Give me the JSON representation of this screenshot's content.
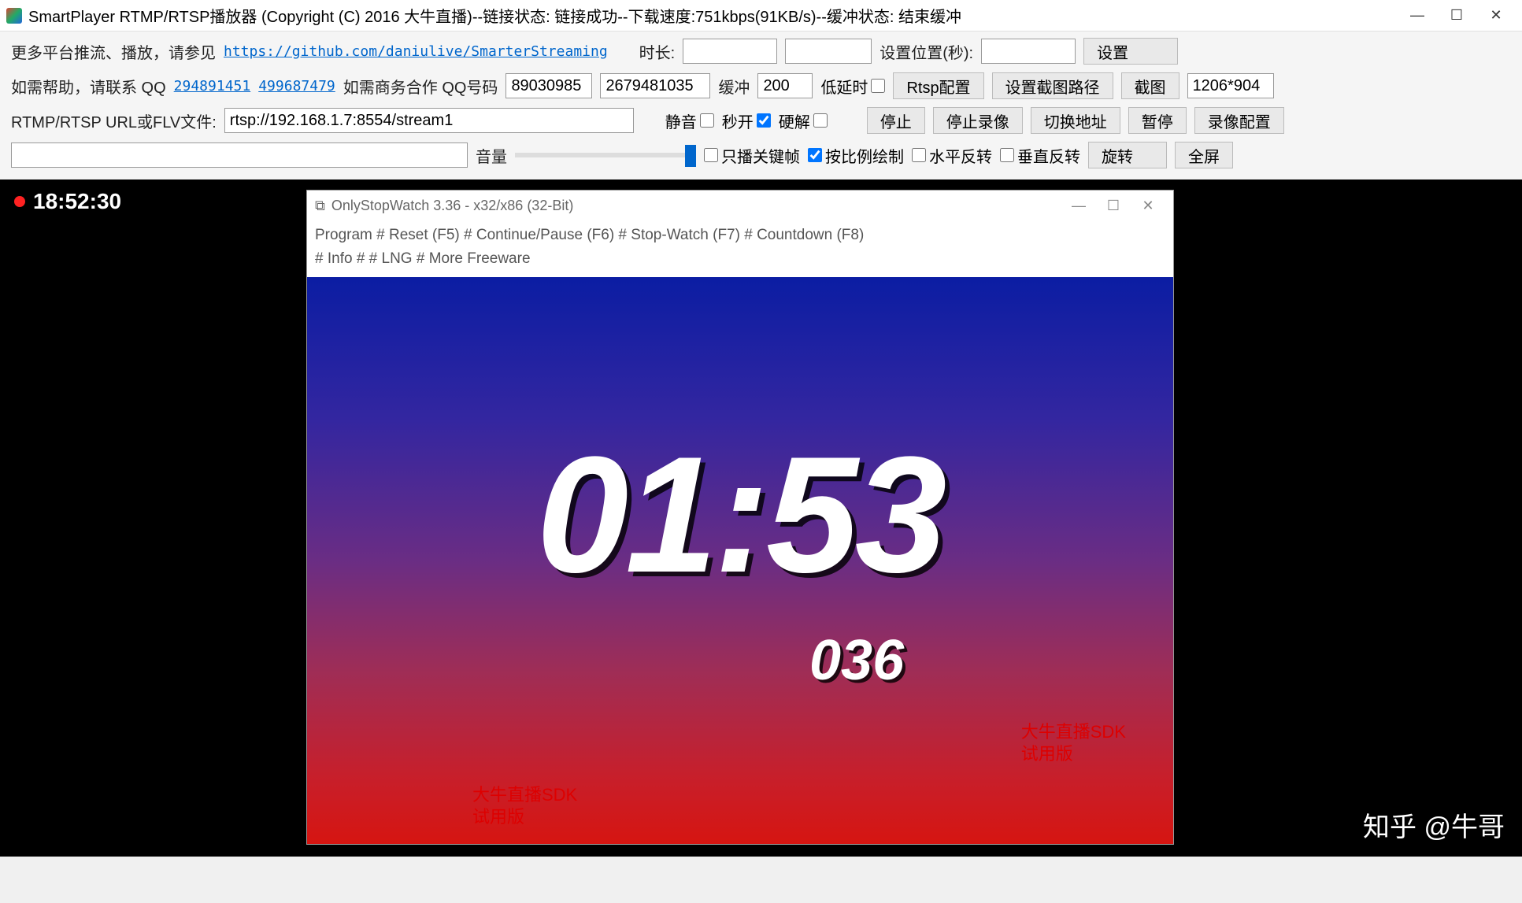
{
  "titlebar": {
    "title": "SmartPlayer RTMP/RTSP播放器 (Copyright (C) 2016 大牛直播)--链接状态: 链接成功--下载速度:751kbps(91KB/s)--缓冲状态: 结束缓冲"
  },
  "row1": {
    "more_platforms": "更多平台推流、播放，请参见",
    "github_link": "https://github.com/daniulive/SmarterStreaming",
    "duration_label": "时长:",
    "duration_value": "",
    "pos_value": "",
    "set_pos_label": "设置位置(秒):",
    "set_pos_value": "",
    "set_btn": "设置"
  },
  "row2": {
    "help_text": "如需帮助，请联系 QQ",
    "qq1": "294891451",
    "qq2": "499687479",
    "biz_text": "如需商务合作 QQ号码",
    "biz_qq1": "89030985",
    "biz_qq2": "2679481035",
    "buffer_label": "缓冲",
    "buffer_value": "200",
    "low_latency": "低延时",
    "rtsp_btn": "Rtsp配置",
    "screenshot_path_btn": "设置截图路径",
    "screenshot_btn": "截图",
    "resolution": "1206*904"
  },
  "row3": {
    "url_label": "RTMP/RTSP URL或FLV文件:",
    "url_value": "rtsp://192.168.1.7:8554/stream1",
    "mute": "静音",
    "fast_open": "秒开",
    "hw_decode": "硬解",
    "stop_btn": "停止",
    "stop_rec_btn": "停止录像",
    "switch_addr_btn": "切换地址",
    "pause_btn": "暂停",
    "rec_cfg_btn": "录像配置"
  },
  "row4": {
    "empty": "",
    "volume_label": "音量",
    "keyframe_only": "只播关键帧",
    "scale_draw": "按比例绘制",
    "hflip": "水平反转",
    "vflip": "垂直反转",
    "rotate_btn": "旋转",
    "fullscreen_btn": "全屏"
  },
  "video": {
    "rec_time": "18:52:30"
  },
  "inner": {
    "title": "OnlyStopWatch 3.36 - x32/x86 (32-Bit)",
    "menu_line1": "Program   #   Reset (F5)   #   Continue/Pause (F6)   #   Stop-Watch (F7)   #   Countdown (F8)",
    "menu_line2": "#   Info   #   # LNG   #   More Freeware",
    "big_time": "01:53",
    "sub_time": "036",
    "watermark1a": "大牛直播SDK",
    "watermark1b": "试用版",
    "watermark2a": "大牛直播SDK",
    "watermark2b": "试用版"
  },
  "footer": {
    "zhihu": "知乎 @牛哥"
  }
}
